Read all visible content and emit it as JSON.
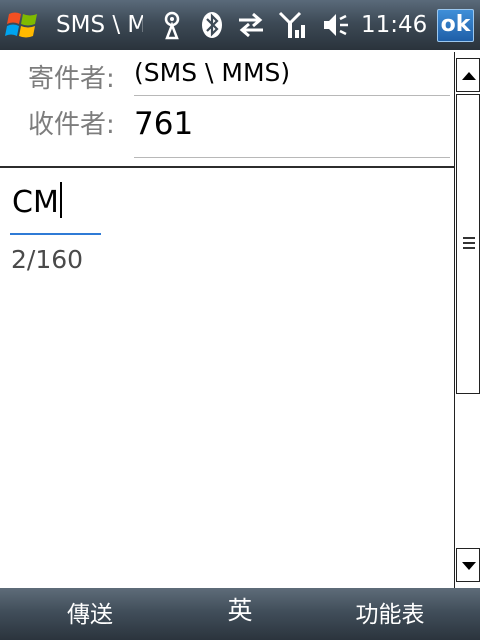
{
  "status_bar": {
    "title": "SMS \\ MMS",
    "time": "11:46",
    "ok_label": "ok",
    "icons": [
      "windows-start-icon",
      "connectivity-icon",
      "bluetooth-icon",
      "data-transfer-icon",
      "signal-strength-icon",
      "speaker-icon"
    ]
  },
  "header": {
    "from_label": "寄件者:",
    "from_value": "(SMS \\ MMS)",
    "to_label": "收件者:",
    "to_value": "761"
  },
  "message": {
    "body": "CM",
    "char_count": "2/160"
  },
  "softkeys": {
    "left": "傳送",
    "middle": "英",
    "right": "功能表"
  },
  "colors": {
    "bar_top": "#5a6a7a",
    "bar_bottom": "#2a333c",
    "accent": "#2f7bd6",
    "ok_button": "#1f5fa8"
  }
}
